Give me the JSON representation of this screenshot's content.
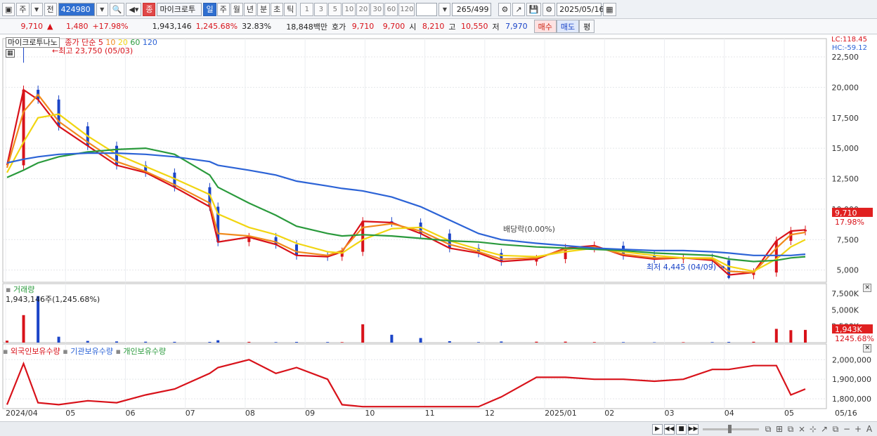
{
  "toolbar": {
    "market": "주",
    "period_type": "전",
    "code": "424980",
    "name_badge": "종",
    "name": "마이크로투",
    "periods": [
      "일",
      "주",
      "월",
      "년",
      "분",
      "초",
      "틱"
    ],
    "minutes": [
      "1",
      "3",
      "5",
      "10",
      "20",
      "30",
      "60",
      "120"
    ],
    "count": "265",
    "total": "/499",
    "date": "2025/05/16"
  },
  "quote": {
    "price": "9,710",
    "arrow": "▲",
    "change": "1,480",
    "change_pct": "+17.98%",
    "volume": "1,943,146",
    "vol_pct": "1,245.68%",
    "turnover": "32.83%",
    "amount": "18,848백만",
    "bid_label": "호가",
    "bid1": "9,710",
    "bid2": "9,700",
    "open_label": "시",
    "open": "8,210",
    "high_label": "고",
    "high": "10,550",
    "low_label": "저",
    "low": "7,970",
    "buy": "매수",
    "sell": "매도",
    "avg": "평"
  },
  "legend": {
    "name": "마이크로투나노",
    "ma_label": "종가 단순",
    "ma": [
      {
        "p": "5",
        "color": "#d8121a"
      },
      {
        "p": "10",
        "color": "#f08a1c"
      },
      {
        "p": "20",
        "color": "#f1d511"
      },
      {
        "p": "60",
        "color": "#2a9a3c"
      },
      {
        "p": "120",
        "color": "#2c63d6"
      }
    ],
    "lc": "LC:118.45",
    "hc": "HC:-59.12"
  },
  "annotations": {
    "high": "최고 23,750 (05/03)",
    "low": "최저 4,445 (04/09)",
    "dividend": "배당락(0.00%)"
  },
  "price_axis": [
    "22,500",
    "20,000",
    "17,500",
    "15,000",
    "12,500",
    "10,000",
    "7,500",
    "5,000"
  ],
  "price_tags": {
    "price": "9,710",
    "pct": "17.98%"
  },
  "volume_panel": {
    "title": "거래량",
    "value": "1,943,146주(1,245.68%)",
    "axis": [
      "7,500K",
      "5,000K",
      "2,500K"
    ],
    "tag": "1,943K",
    "tag_pct": "1245.68%"
  },
  "holdings_panel": {
    "legend": [
      {
        "label": "외국인보유수량",
        "color": "#d8121a"
      },
      {
        "label": "기관보유수량",
        "color": "#2c63d6"
      },
      {
        "label": "개인보유수량",
        "color": "#2a9a3c"
      }
    ],
    "axis": [
      "2,000,000",
      "1,900,000",
      "1,800,000"
    ]
  },
  "x_axis": [
    "2024/04",
    "05",
    "06",
    "07",
    "08",
    "09",
    "10",
    "11",
    "12",
    "2025/01",
    "02",
    "03",
    "04",
    "05"
  ],
  "x_right": "05/16",
  "colors": {
    "up": "#d8121a",
    "down": "#1b45c8",
    "accent": "#2f6fd0"
  },
  "chart_data": {
    "type": "line",
    "x": [
      "2024/04/25",
      "2024/05/03",
      "2024/05/10",
      "2024/05/20",
      "2024/06/03",
      "2024/06/17",
      "2024/07/01",
      "2024/07/15",
      "2024/08/01",
      "2024/08/05",
      "2024/08/20",
      "2024/09/02",
      "2024/09/12",
      "2024/09/27",
      "2024/10/04",
      "2024/10/14",
      "2024/10/28",
      "2024/11/11",
      "2024/11/25",
      "2024/12/09",
      "2024/12/20",
      "2025/01/06",
      "2025/01/20",
      "2025/02/03",
      "2025/02/17",
      "2025/03/04",
      "2025/03/18",
      "2025/04/01",
      "2025/04/09",
      "2025/04/21",
      "2025/05/02",
      "2025/05/09",
      "2025/05/16"
    ],
    "series": [
      {
        "name": "5",
        "values": [
          13600,
          19800,
          19000,
          16800,
          15200,
          13600,
          13000,
          11800,
          10200,
          7300,
          7700,
          7100,
          6200,
          6100,
          6500,
          9000,
          8900,
          8000,
          6800,
          6400,
          5700,
          5900,
          6800,
          7000,
          6200,
          5900,
          6000,
          5800,
          4600,
          4800,
          7400,
          8200,
          8300
        ]
      },
      {
        "name": "10",
        "values": [
          13400,
          18000,
          19400,
          17200,
          15500,
          13900,
          13100,
          12000,
          10500,
          8000,
          7800,
          7300,
          6500,
          6200,
          6600,
          8500,
          8800,
          8200,
          7100,
          6500,
          5900,
          6000,
          6700,
          6900,
          6300,
          6000,
          6000,
          5900,
          4900,
          4800,
          6800,
          7900,
          8100
        ]
      },
      {
        "name": "20",
        "values": [
          13000,
          15500,
          17500,
          17800,
          16000,
          14500,
          13500,
          12500,
          11200,
          9600,
          8500,
          7900,
          7200,
          6500,
          6400,
          7500,
          8400,
          8500,
          7400,
          6700,
          6200,
          6100,
          6500,
          6800,
          6500,
          6200,
          6000,
          6000,
          5300,
          4900,
          5900,
          6900,
          7500
        ]
      },
      {
        "name": "60",
        "values": [
          12600,
          13200,
          13800,
          14300,
          14700,
          14900,
          15000,
          14500,
          12800,
          11800,
          10500,
          9500,
          8600,
          8000,
          7800,
          7900,
          7800,
          7600,
          7400,
          7300,
          7100,
          6900,
          6800,
          6700,
          6600,
          6400,
          6300,
          6200,
          5900,
          5700,
          5800,
          6000,
          6100
        ]
      },
      {
        "name": "120",
        "values": [
          13800,
          14100,
          14300,
          14500,
          14600,
          14600,
          14500,
          14300,
          13900,
          13600,
          13200,
          12800,
          12300,
          11900,
          11700,
          11500,
          11000,
          10200,
          9100,
          8000,
          7500,
          7200,
          7000,
          6800,
          6700,
          6600,
          6600,
          6500,
          6400,
          6200,
          6200,
          6200,
          6300
        ]
      }
    ],
    "high": {
      "date": "2024/05/03",
      "value": 23750
    },
    "low": {
      "date": "2025/04/09",
      "value": 4445
    },
    "last": 9710,
    "ylim": [
      4000,
      24000
    ],
    "volume_k": [
      300,
      4200,
      7100,
      900,
      260,
      180,
      140,
      120,
      110,
      360,
      120,
      80,
      110,
      90,
      80,
      2800,
      1200,
      700,
      220,
      80,
      170,
      140,
      150,
      90,
      80,
      60,
      70,
      80,
      110,
      130,
      2100,
      1900,
      1943
    ],
    "holdings": {
      "ylim": [
        1750000,
        2080000
      ],
      "foreign": [
        1770000,
        1980000,
        1780000,
        1770000,
        1790000,
        1780000,
        1820000,
        1850000,
        1930000,
        1960000,
        2000000,
        1930000,
        1960000,
        1900000,
        1770000,
        1760000,
        1760000,
        1760000,
        1760000,
        1760000,
        1810000,
        1910000,
        1910000,
        1900000,
        1900000,
        1890000,
        1900000,
        1950000,
        1950000,
        1970000,
        1970000,
        1820000,
        1850000
      ]
    }
  }
}
